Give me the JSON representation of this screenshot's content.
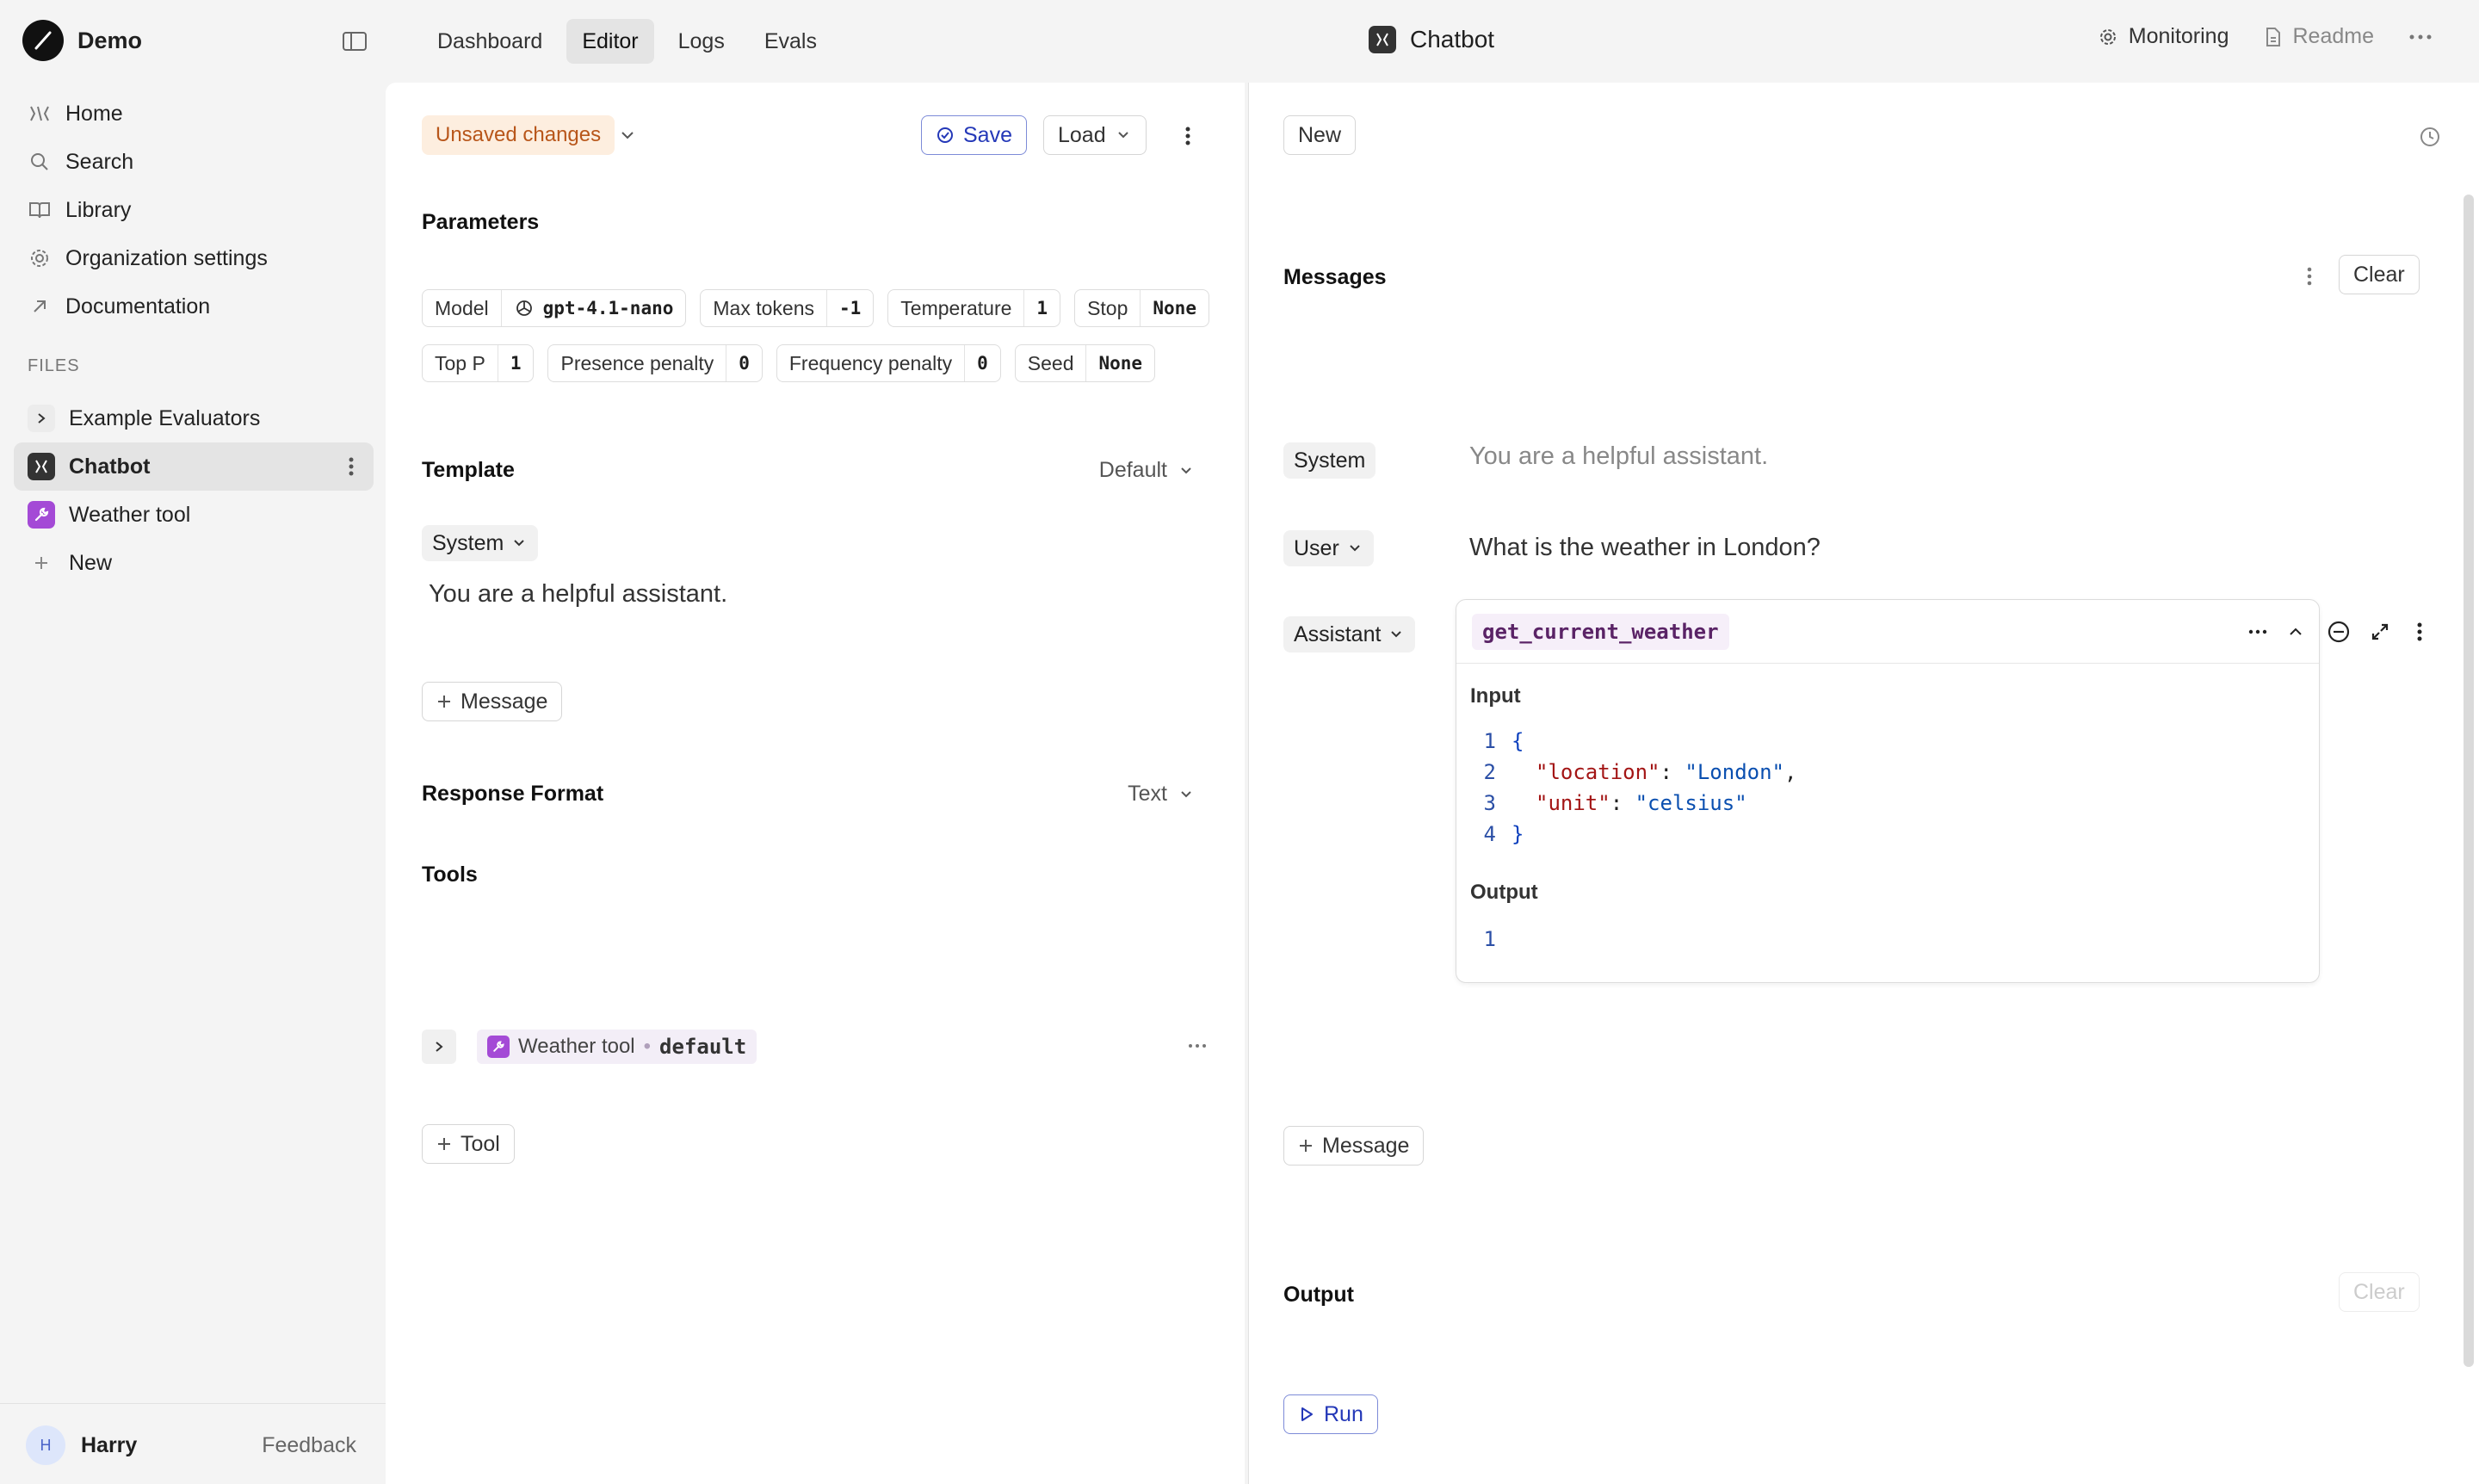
{
  "header": {
    "app_name": "Demo",
    "tabs": [
      {
        "label": "Dashboard"
      },
      {
        "label": "Editor"
      },
      {
        "label": "Logs"
      },
      {
        "label": "Evals"
      }
    ],
    "file_title": "Chatbot",
    "monitoring": "Monitoring",
    "readme": "Readme"
  },
  "sidebar": {
    "nav": [
      {
        "label": "Home",
        "icon": "home-icon"
      },
      {
        "label": "Search",
        "icon": "search-icon"
      },
      {
        "label": "Library",
        "icon": "book-icon"
      },
      {
        "label": "Organization settings",
        "icon": "gear-icon"
      },
      {
        "label": "Documentation",
        "icon": "arrow-up-right-icon"
      }
    ],
    "files_label": "FILES",
    "files": [
      {
        "label": "Example Evaluators",
        "icon": "chevron-right-icon"
      },
      {
        "label": "Chatbot",
        "icon": "prompt-file-icon",
        "active": true
      },
      {
        "label": "Weather tool",
        "icon": "wrench-icon"
      },
      {
        "label": "New",
        "icon": "plus-icon"
      }
    ],
    "user": {
      "initial": "H",
      "name": "Harry"
    },
    "feedback": "Feedback"
  },
  "editor": {
    "status": "Unsaved changes",
    "save": "Save",
    "load": "Load",
    "parameters_title": "Parameters",
    "params": {
      "model": {
        "label": "Model",
        "value": "gpt-4.1-nano"
      },
      "max_tokens": {
        "label": "Max tokens",
        "value": "-1"
      },
      "temperature": {
        "label": "Temperature",
        "value": "1"
      },
      "stop": {
        "label": "Stop",
        "value": "None"
      },
      "top_p": {
        "label": "Top P",
        "value": "1"
      },
      "presence_penalty": {
        "label": "Presence penalty",
        "value": "0"
      },
      "frequency_penalty": {
        "label": "Frequency penalty",
        "value": "0"
      },
      "seed": {
        "label": "Seed",
        "value": "None"
      }
    },
    "template_title": "Template",
    "template_mode": "Default",
    "template_role": "System",
    "template_text": "You are a helpful assistant.",
    "add_message": "Message",
    "response_format_title": "Response Format",
    "response_format_value": "Text",
    "tools_title": "Tools",
    "tool": {
      "name": "Weather tool",
      "separator": "•",
      "version": "default"
    },
    "add_tool": "Tool"
  },
  "playground": {
    "new": "New",
    "messages_title": "Messages",
    "clear": "Clear",
    "messages": [
      {
        "role": "System",
        "text": "You are a helpful assistant."
      },
      {
        "role": "User",
        "text": "What is the weather in London?"
      },
      {
        "role": "Assistant",
        "text": ""
      }
    ],
    "tool_call": {
      "function": "get_current_weather",
      "input_label": "Input",
      "input_lines": [
        {
          "n": "1",
          "open": "{"
        },
        {
          "n": "2",
          "key": "\"location\"",
          "colon": ": ",
          "value": "\"London\"",
          "comma": ","
        },
        {
          "n": "3",
          "key": "\"unit\"",
          "colon": ": ",
          "value": "\"celsius\""
        },
        {
          "n": "4",
          "close": "}"
        }
      ],
      "output_label": "Output",
      "output_lines": [
        {
          "n": "1"
        }
      ]
    },
    "add_message": "Message",
    "output_title": "Output",
    "output_clear": "Clear",
    "run": "Run"
  },
  "colors": {
    "accent": "#2438b8",
    "unsaved_bg": "#fdeedf",
    "unsaved_text": "#b8561a",
    "tool_icon": "#a44ad6"
  }
}
